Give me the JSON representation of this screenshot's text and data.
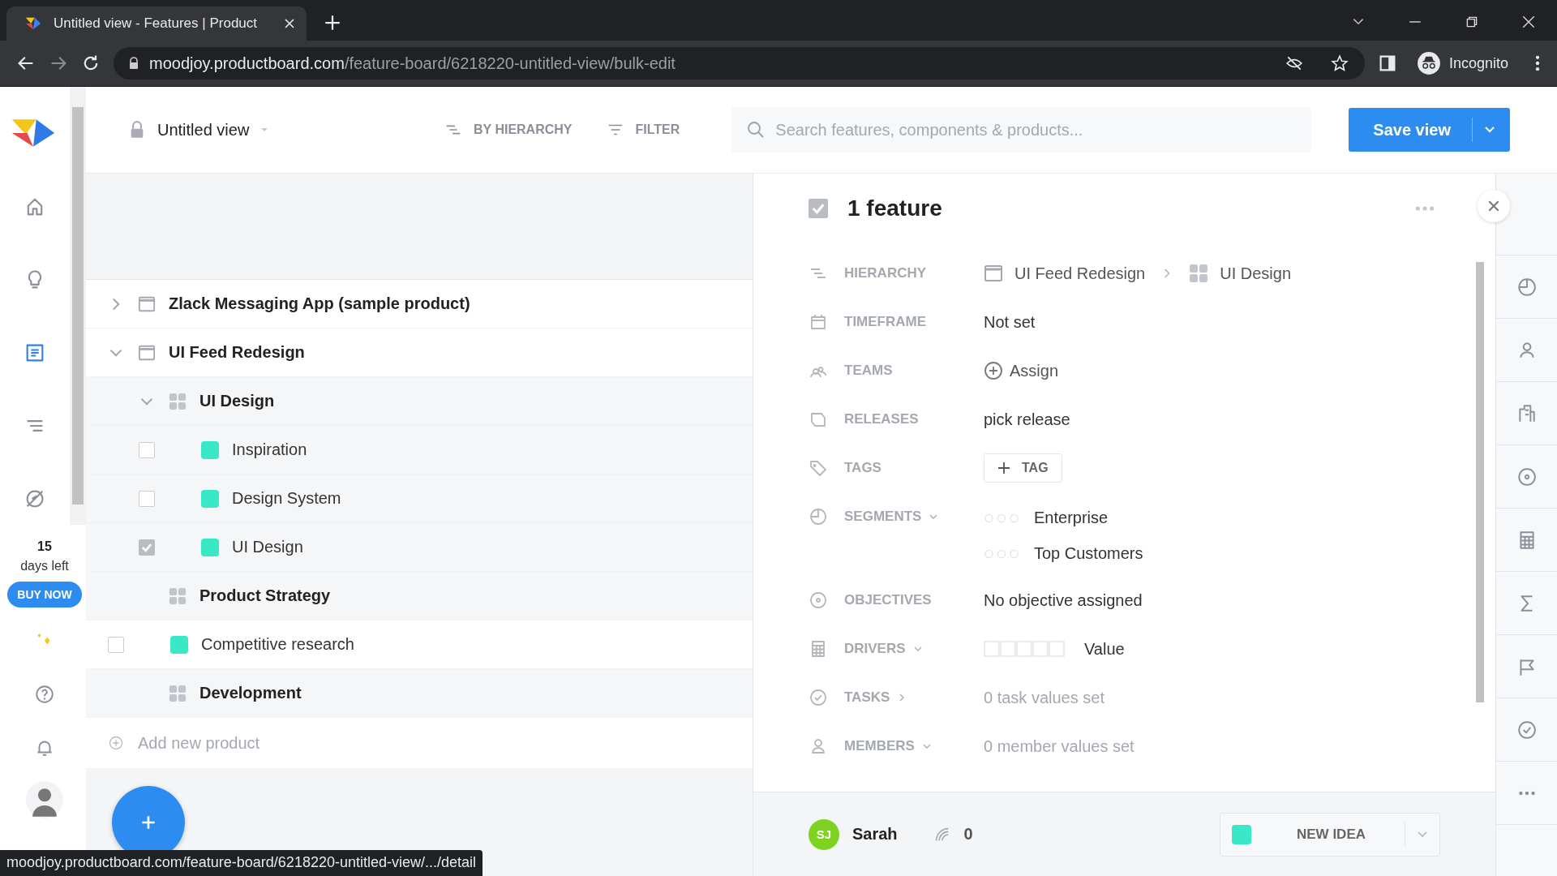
{
  "browser": {
    "tab_title": "Untitled view - Features | Product",
    "url_host": "moodjoy.productboard.com",
    "url_path": "/feature-board/6218220-untitled-view/bulk-edit",
    "profile_label": "Incognito"
  },
  "sidebar": {
    "items": [
      {
        "selected": false
      },
      {
        "selected": false
      },
      {
        "selected": true
      },
      {
        "selected": false
      },
      {
        "selected": false
      }
    ],
    "trial_days": "15",
    "trial_label": "days left",
    "buy_button": "BUY NOW"
  },
  "header": {
    "view_name": "Untitled view",
    "group_by": "BY HIERARCHY",
    "filter": "FILTER",
    "search_placeholder": "Search features, components & products...",
    "save_button": "Save view"
  },
  "tree": [
    {
      "kind": "product",
      "label": "Zlack Messaging App (sample product)",
      "expanded": false
    },
    {
      "kind": "product",
      "label": "UI Feed Redesign",
      "expanded": true,
      "children": [
        {
          "kind": "component",
          "label": "UI Design",
          "expanded": true,
          "children": [
            {
              "kind": "feature",
              "label": "Inspiration",
              "checked": false
            },
            {
              "kind": "feature",
              "label": "Design System",
              "checked": false
            },
            {
              "kind": "feature",
              "label": "UI Design",
              "checked": true
            }
          ]
        },
        {
          "kind": "component",
          "label": "Product Strategy"
        },
        {
          "kind": "feature",
          "label": "Competitive research",
          "checked": false
        },
        {
          "kind": "component",
          "label": "Development"
        }
      ]
    }
  ],
  "add_product": "Add new product",
  "status_url": "moodjoy.productboard.com/feature-board/6218220-untitled-view/.../detail",
  "detail": {
    "title": "1 feature",
    "checked": true,
    "fields": [
      {
        "kind": "hierarchy",
        "label": "HIERARCHY",
        "path": [
          {
            "kind": "product",
            "label": "UI Feed Redesign"
          },
          {
            "kind": "component",
            "label": "UI Design"
          }
        ]
      },
      {
        "kind": "text",
        "label": "TIMEFRAME",
        "value": "Not set"
      },
      {
        "kind": "assign",
        "label": "TEAMS",
        "value": "Assign"
      },
      {
        "kind": "text",
        "label": "RELEASES",
        "value": "pick release"
      },
      {
        "kind": "tag",
        "label": "TAGS",
        "value": "TAG"
      },
      {
        "kind": "segments",
        "label": "SEGMENTS",
        "dropdown": true,
        "items": [
          "Enterprise",
          "Top Customers"
        ]
      },
      {
        "kind": "text",
        "label": "OBJECTIVES",
        "value": "No objective assigned"
      },
      {
        "kind": "drivers",
        "label": "DRIVERS",
        "dropdown": true,
        "value": "Value"
      },
      {
        "kind": "muted",
        "label": "TASKS",
        "expandable": true,
        "value": "0 task values set"
      },
      {
        "kind": "muted",
        "label": "MEMBERS",
        "dropdown": true,
        "value": "0 member values set"
      }
    ],
    "footer": {
      "initials": "SJ",
      "name": "Sarah",
      "count": "0",
      "new_idea": "NEW IDEA"
    }
  }
}
